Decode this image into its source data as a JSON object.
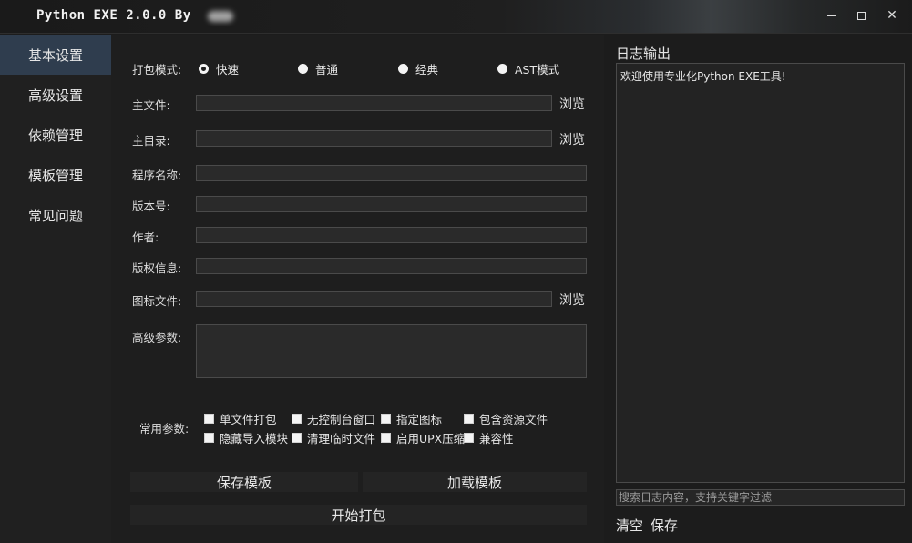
{
  "window": {
    "title": "Python EXE 2.0.0 By",
    "close_glyph": "✕"
  },
  "sidebar": {
    "items": [
      {
        "label": "基本设置"
      },
      {
        "label": "高级设置"
      },
      {
        "label": "依赖管理"
      },
      {
        "label": "模板管理"
      },
      {
        "label": "常见问题"
      }
    ],
    "active_index": 0
  },
  "pack_mode": {
    "label": "打包模式:",
    "options": [
      "快速",
      "普通",
      "经典",
      "AST模式"
    ],
    "selected": "快速"
  },
  "fields": {
    "main_file": {
      "label": "主文件:",
      "value": ""
    },
    "main_dir": {
      "label": "主目录:",
      "value": ""
    },
    "program_name": {
      "label": "程序名称:",
      "value": ""
    },
    "version": {
      "label": "版本号:",
      "value": ""
    },
    "author": {
      "label": "作者:",
      "value": ""
    },
    "copyright": {
      "label": "版权信息:",
      "value": ""
    },
    "icon_file": {
      "label": "图标文件:",
      "value": ""
    },
    "advanced_params": {
      "label": "高级参数:",
      "value": ""
    }
  },
  "browse_label": "浏览",
  "common_params": {
    "label": "常用参数:",
    "options": [
      {
        "label": "单文件打包",
        "checked": false
      },
      {
        "label": "无控制台窗口",
        "checked": false
      },
      {
        "label": "指定图标",
        "checked": false
      },
      {
        "label": "包含资源文件",
        "checked": false
      },
      {
        "label": "隐藏导入模块",
        "checked": false
      },
      {
        "label": "清理临时文件",
        "checked": false
      },
      {
        "label": "启用UPX压缩",
        "checked": false
      },
      {
        "label": "兼容性",
        "checked": false
      }
    ]
  },
  "buttons": {
    "save_template": "保存模板",
    "load_template": "加载模板",
    "start_pack": "开始打包"
  },
  "log": {
    "title": "日志输出",
    "lines": [
      "欢迎使用专业化Python EXE工具!"
    ],
    "search_placeholder": "搜索日志内容，支持关键字过滤",
    "clear_label": "清空",
    "save_label": "保存"
  },
  "colors": {
    "background": "#1e1e1e",
    "sidebar_active": "#2f3d4e",
    "text": "#e6e6e6"
  }
}
